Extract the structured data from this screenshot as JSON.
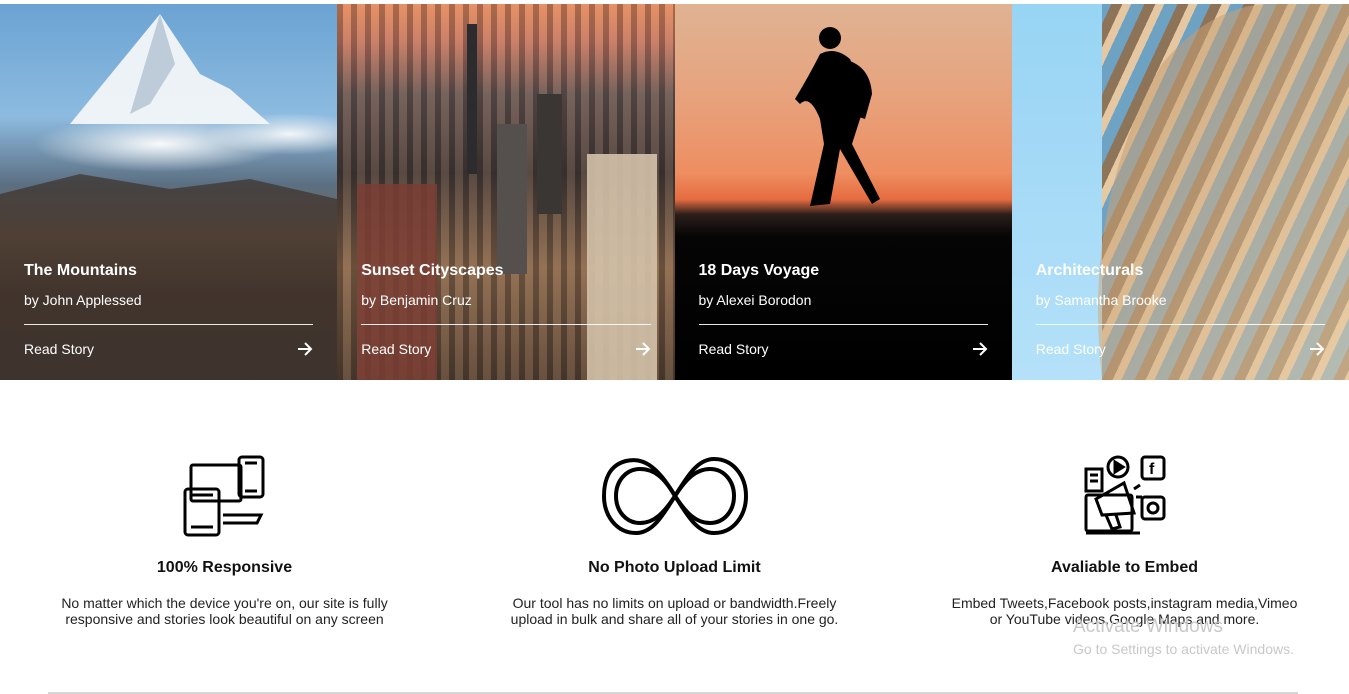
{
  "cards": [
    {
      "title": "The Mountains",
      "author": "by John Applessed",
      "link": "Read Story",
      "image": "mountain-photo"
    },
    {
      "title": "Sunset Cityscapes",
      "author": "by Benjamin Cruz",
      "link": "Read Story",
      "image": "city-photo"
    },
    {
      "title": "18 Days Voyage",
      "author": "by Alexei Borodon",
      "link": "Read Story",
      "image": "walker-silhouette-photo"
    },
    {
      "title": "Architecturals",
      "author": "by Samantha Brooke",
      "link": "Read Story",
      "image": "building-photo"
    }
  ],
  "features": [
    {
      "icon": "devices-icon",
      "title": "100% Responsive",
      "description": "No matter which the device you're on, our site is fully responsive and stories look beautiful on any screen"
    },
    {
      "icon": "infinity-icon",
      "title": "No Photo Upload Limit",
      "description": "Our tool has no limits on upload or bandwidth.Freely upload in bulk and share all of your stories in one go."
    },
    {
      "icon": "embed-megaphone-icon",
      "title": "Avaliable to Embed",
      "description": "Embed Tweets,Facebook posts,instagram media,Vimeo or YouTube videos,Google Maps and more."
    }
  ],
  "watermark": {
    "title": "Activate Windows",
    "subtitle": "Go to Settings to activate Windows."
  }
}
